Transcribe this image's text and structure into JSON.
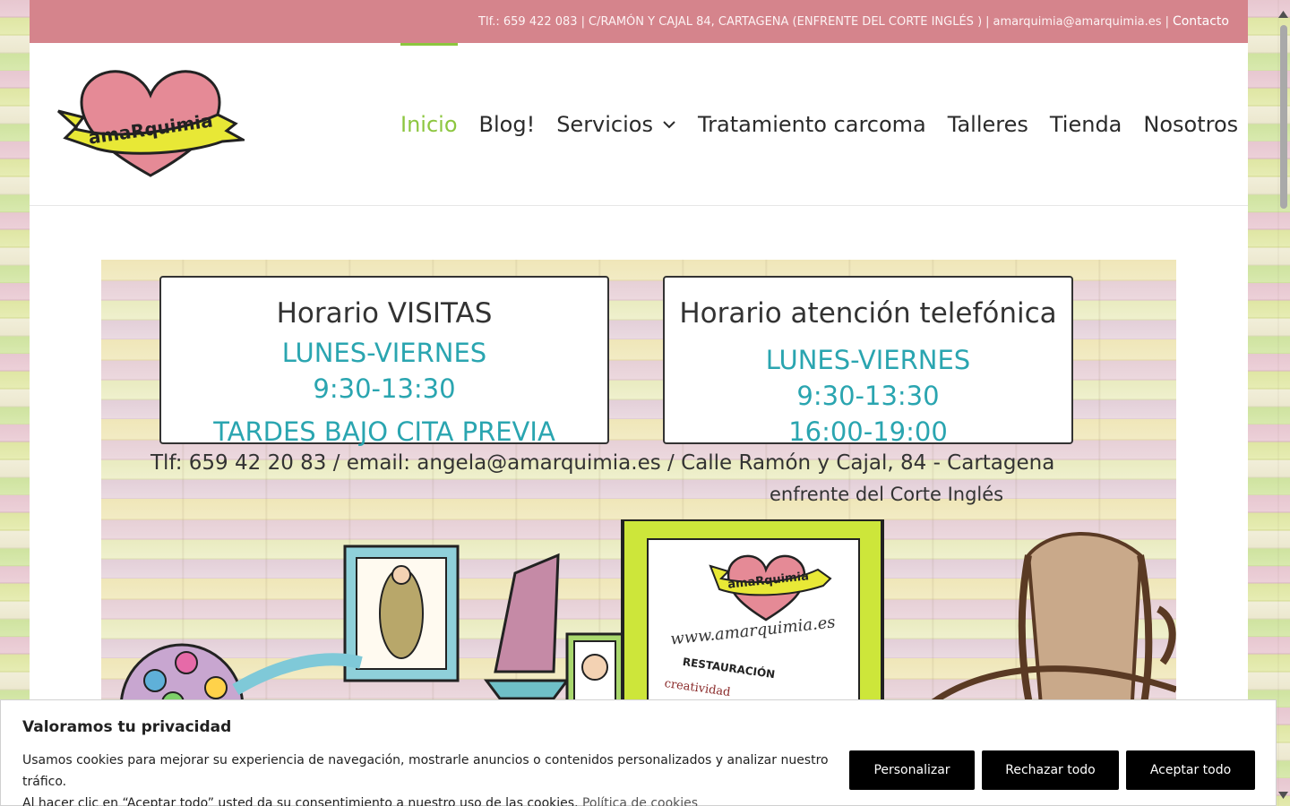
{
  "topbar": {
    "phone": "Tlf.: 659 422 083",
    "address": "C/RAMÓN Y CAJAL 84, CARTAGENA (ENFRENTE DEL CORTE INGLÉS )",
    "email": "amarquimia@amarquimia.es",
    "contact_label": "Contacto",
    "separator": "|"
  },
  "logo": {
    "text": "amaRquimia"
  },
  "nav": {
    "items": [
      {
        "label": "Inicio",
        "active": true
      },
      {
        "label": "Blog!"
      },
      {
        "label": "Servicios",
        "has_dropdown": true
      },
      {
        "label": "Tratamiento carcoma"
      },
      {
        "label": "Talleres"
      },
      {
        "label": "Tienda"
      },
      {
        "label": "Nosotros"
      }
    ]
  },
  "banner": {
    "sign1": {
      "heading": "Horario VISITAS",
      "line1": "LUNES-VIERNES",
      "line2": "9:30-13:30",
      "line3": "TARDES BAJO CITA PREVIA"
    },
    "sign2": {
      "heading": "Horario atención telefónica",
      "line1": "LUNES-VIERNES",
      "line2": "9:30-13:30",
      "line3": "16:00-19:00"
    },
    "contact_line": "Tlf: 659 42 20 83 / email: angela@amarquimia.es / Calle Ramón y Cajal, 84 - Cartagena",
    "contact_line2": "enfrente del Corte Inglés",
    "art_logo": "amaRquimia",
    "art_url": "www.amarquimia.es",
    "art_text1": "RESTAURACIÓN",
    "art_text2": "creatividad"
  },
  "cookie": {
    "title": "Valoramos tu privacidad",
    "text1": "Usamos cookies para mejorar su experiencia de navegación, mostrarle anuncios o contenidos personalizados y analizar nuestro tráfico.",
    "text2": "Al hacer clic en “Aceptar todo” usted da su consentimiento a nuestro uso de las cookies.",
    "policy_link": "Política de cookies",
    "btn_customize": "Personalizar",
    "btn_reject": "Rechazar todo",
    "btn_accept": "Aceptar todo"
  },
  "colors": {
    "topbar": "#d5848c",
    "accent_green": "#8cc63f",
    "heart_pink": "#e58a96",
    "ribbon_yellow": "#e8e836",
    "sign_teal": "#2aa5b0"
  }
}
